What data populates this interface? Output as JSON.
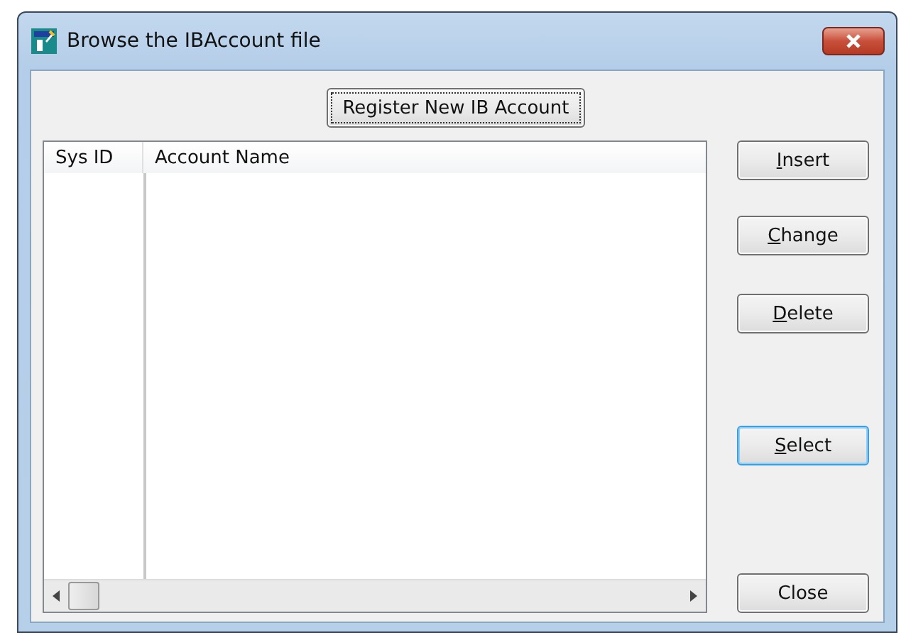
{
  "window": {
    "title": "Browse the IBAccount file"
  },
  "top_button": {
    "label": "Register New IB Account",
    "focused": true
  },
  "table": {
    "columns": [
      "Sys ID",
      "Account Name"
    ]
  },
  "buttons": [
    {
      "label": "Insert",
      "underline_first": true,
      "default": false
    },
    {
      "label": "Change",
      "underline_first": true,
      "default": false
    },
    {
      "label": "Delete",
      "underline_first": true,
      "default": false
    },
    {
      "label": "Select",
      "underline_first": true,
      "default": true
    },
    {
      "label": "Close",
      "underline_first": false,
      "default": false
    }
  ]
}
